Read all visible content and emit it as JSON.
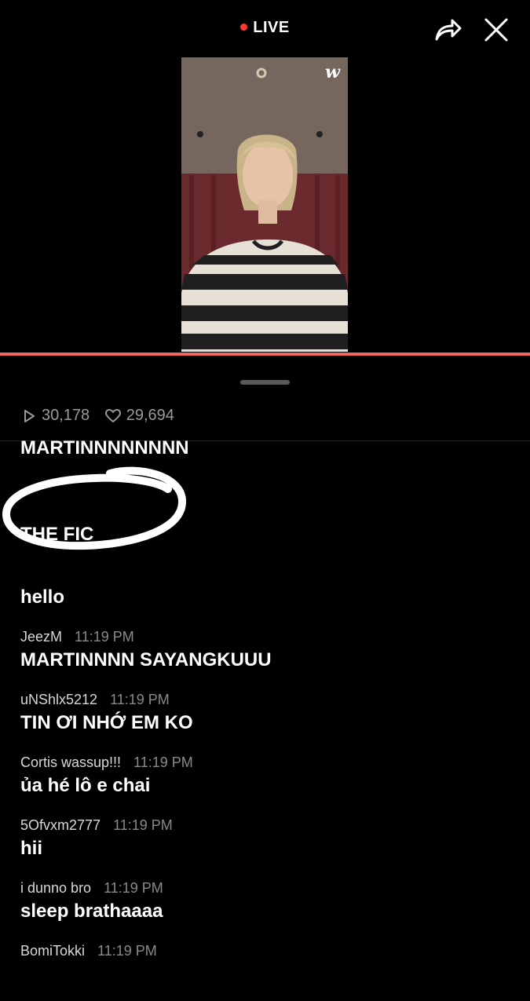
{
  "header": {
    "live_label": "LIVE",
    "live_dot_color": "#ff3b30",
    "share_icon": "share-arrow-icon",
    "close_icon": "close-icon"
  },
  "player": {
    "watermark": "w",
    "progress_fraction": 1.0,
    "progress_color": "#f2665f"
  },
  "stats": {
    "views": "30,178",
    "likes": "29,694"
  },
  "comments": [
    {
      "user": "",
      "time": "",
      "text": "MARTINNNNNNNN"
    },
    {
      "user": "",
      "time": "",
      "text": "THE FIC"
    },
    {
      "user": "",
      "time": "",
      "text": "hello"
    },
    {
      "user": "JeezM",
      "time": "11:19 PM",
      "text": "MARTINNNN SAYANGKUUU"
    },
    {
      "user": "uNShlx5212",
      "time": "11:19 PM",
      "text": "TIN ƠI NHỚ EM KO"
    },
    {
      "user": "Cortis wassup!!!",
      "time": "11:19 PM",
      "text": "ủa hé lô e chai"
    },
    {
      "user": "5Ofvxm2777",
      "time": "11:19 PM",
      "text": "hii"
    },
    {
      "user": "i dunno bro",
      "time": "11:19 PM",
      "text": "sleep brathaaaa"
    },
    {
      "user": "BomiTokki",
      "time": "11:19 PM",
      "text": ""
    }
  ]
}
